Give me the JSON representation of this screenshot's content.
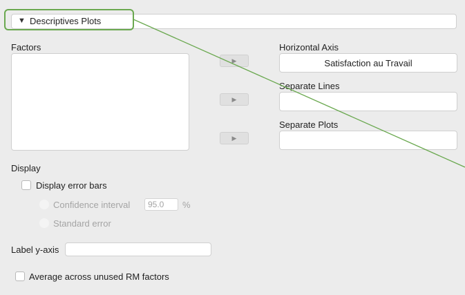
{
  "section": {
    "title": "Descriptives Plots",
    "toggle_icon": "triangle-down-icon"
  },
  "factors": {
    "label": "Factors",
    "items": []
  },
  "assign_buttons": {
    "icon": "arrow-right-icon",
    "glyph": "▶"
  },
  "targets": {
    "horizontal_axis": {
      "label": "Horizontal Axis",
      "value": "Satisfaction au Travail"
    },
    "separate_lines": {
      "label": "Separate Lines",
      "value": ""
    },
    "separate_plots": {
      "label": "Separate Plots",
      "value": ""
    }
  },
  "display": {
    "label": "Display",
    "error_bars": {
      "label": "Display error bars",
      "checked": false
    },
    "confidence_interval": {
      "label": "Confidence interval",
      "value": "95.0",
      "unit": "%"
    },
    "standard_error": {
      "label": "Standard error"
    }
  },
  "label_y_axis": {
    "label": "Label y-axis",
    "value": ""
  },
  "average_rm": {
    "label": "Average across unused RM factors",
    "checked": false
  },
  "colors": {
    "highlight": "#6aa84f",
    "pointer_line": "#6aa84f"
  }
}
